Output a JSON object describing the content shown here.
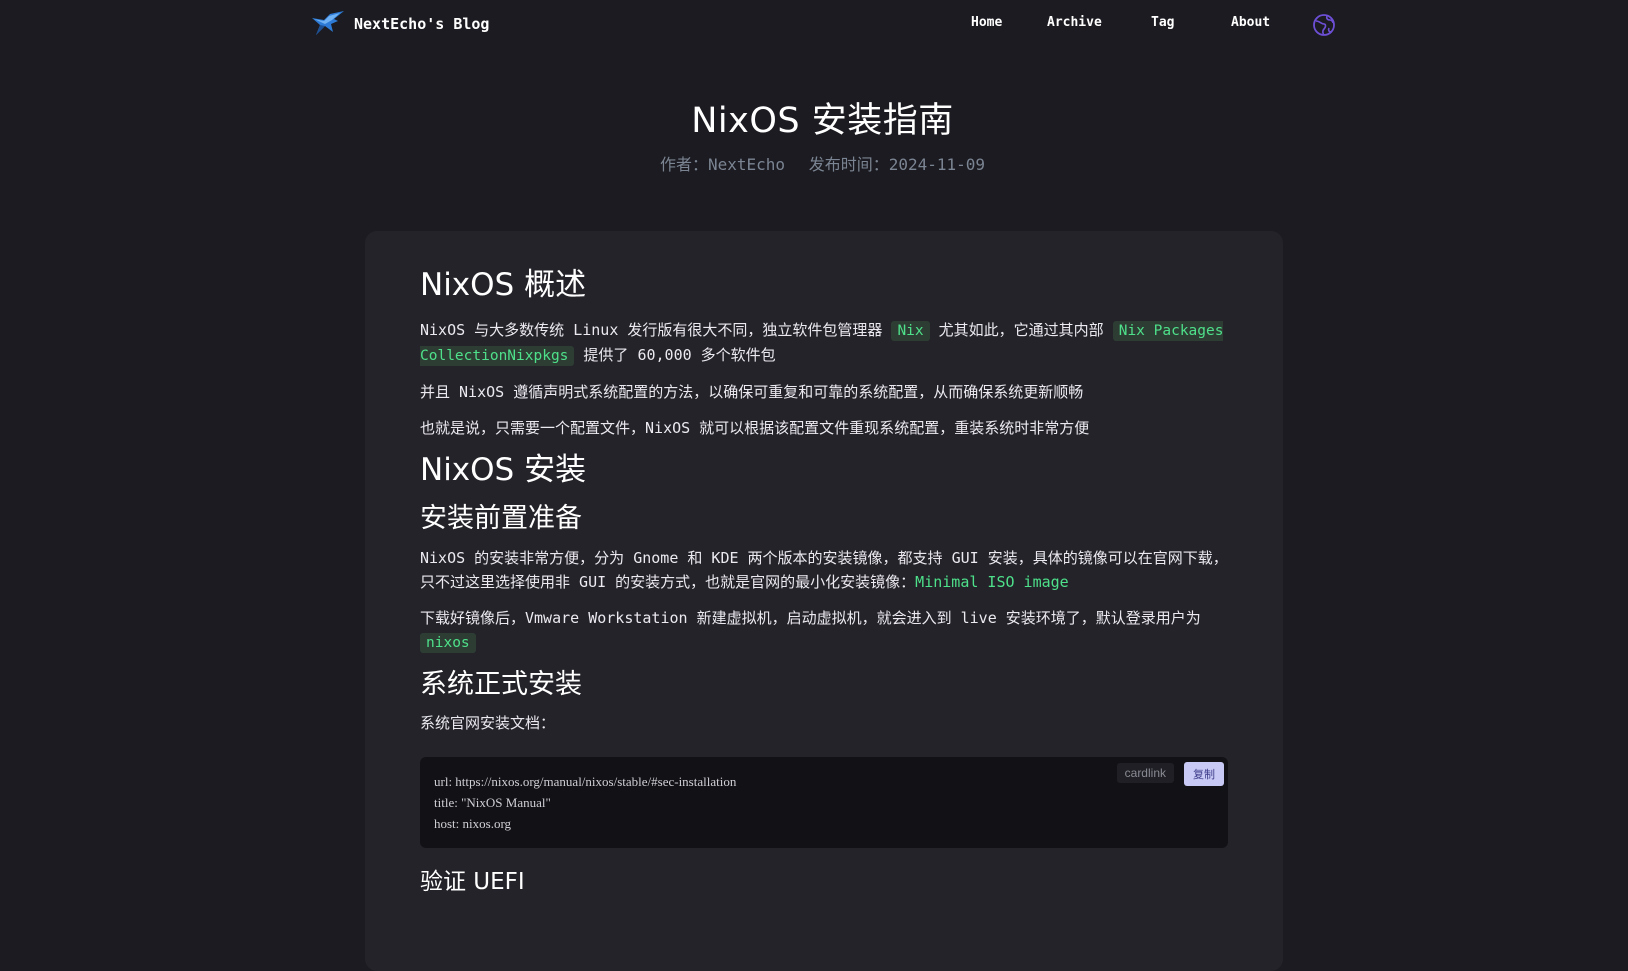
{
  "header": {
    "site_name": "NextEcho's Blog",
    "nav": [
      "Home",
      "Archive",
      "Tag",
      "About"
    ],
    "logo_icon": "bird-logo-icon",
    "lang_icon": "globe-icon"
  },
  "post": {
    "title": "NixOS 安装指南",
    "author": "作者：NextEcho",
    "date": "发布时间：2024-11-09"
  },
  "content": {
    "h_overview": "NixOS 概述",
    "p1_a": "NixOS 与大多数传统 Linux 发行版有很大不同，独立软件包管理器 ",
    "p1_code1": "Nix",
    "p1_b": " 尤其如此，它通过其内部 ",
    "p1_code2": "Nix Packages CollectionNixpkgs",
    "p1_c": " 提供了 60,000 多个软件包",
    "p2": "并且 NixOS 遵循声明式系统配置的方法，以确保可重复和可靠的系统配置，从而确保系统更新顺畅",
    "p3": "也就是说，只需要一个配置文件，NixOS 就可以根据该配置文件重现系统配置，重装系统时非常方便",
    "h_install": "NixOS 安装",
    "h_prep": "安装前置准备",
    "p4_a": "NixOS 的安装非常方便，分为 Gnome 和 KDE 两个版本的安装镜像，都支持 GUI 安装，具体的镜像可以在官网下载，只不过这里选择使用非 GUI 的安装方式，也就是官网的最小化安装镜像：",
    "p4_link": "Minimal ISO image",
    "p5_a": "下载好镜像后，Vmware Workstation 新建虚拟机，启动虚拟机，就会进入到 live 安装环境了，默认登录用户为 ",
    "p5_code": "nixos",
    "h_formal": "系统正式安装",
    "p6": "系统官网安装文档：",
    "code_lang": "cardlink",
    "copy_label": "复制",
    "code_lines": [
      "url: https://nixos.org/manual/nixos/stable/#sec-installation",
      "title: \"NixOS Manual\"",
      "host: nixos.org"
    ],
    "h_uefi": "验证 UEFI"
  }
}
